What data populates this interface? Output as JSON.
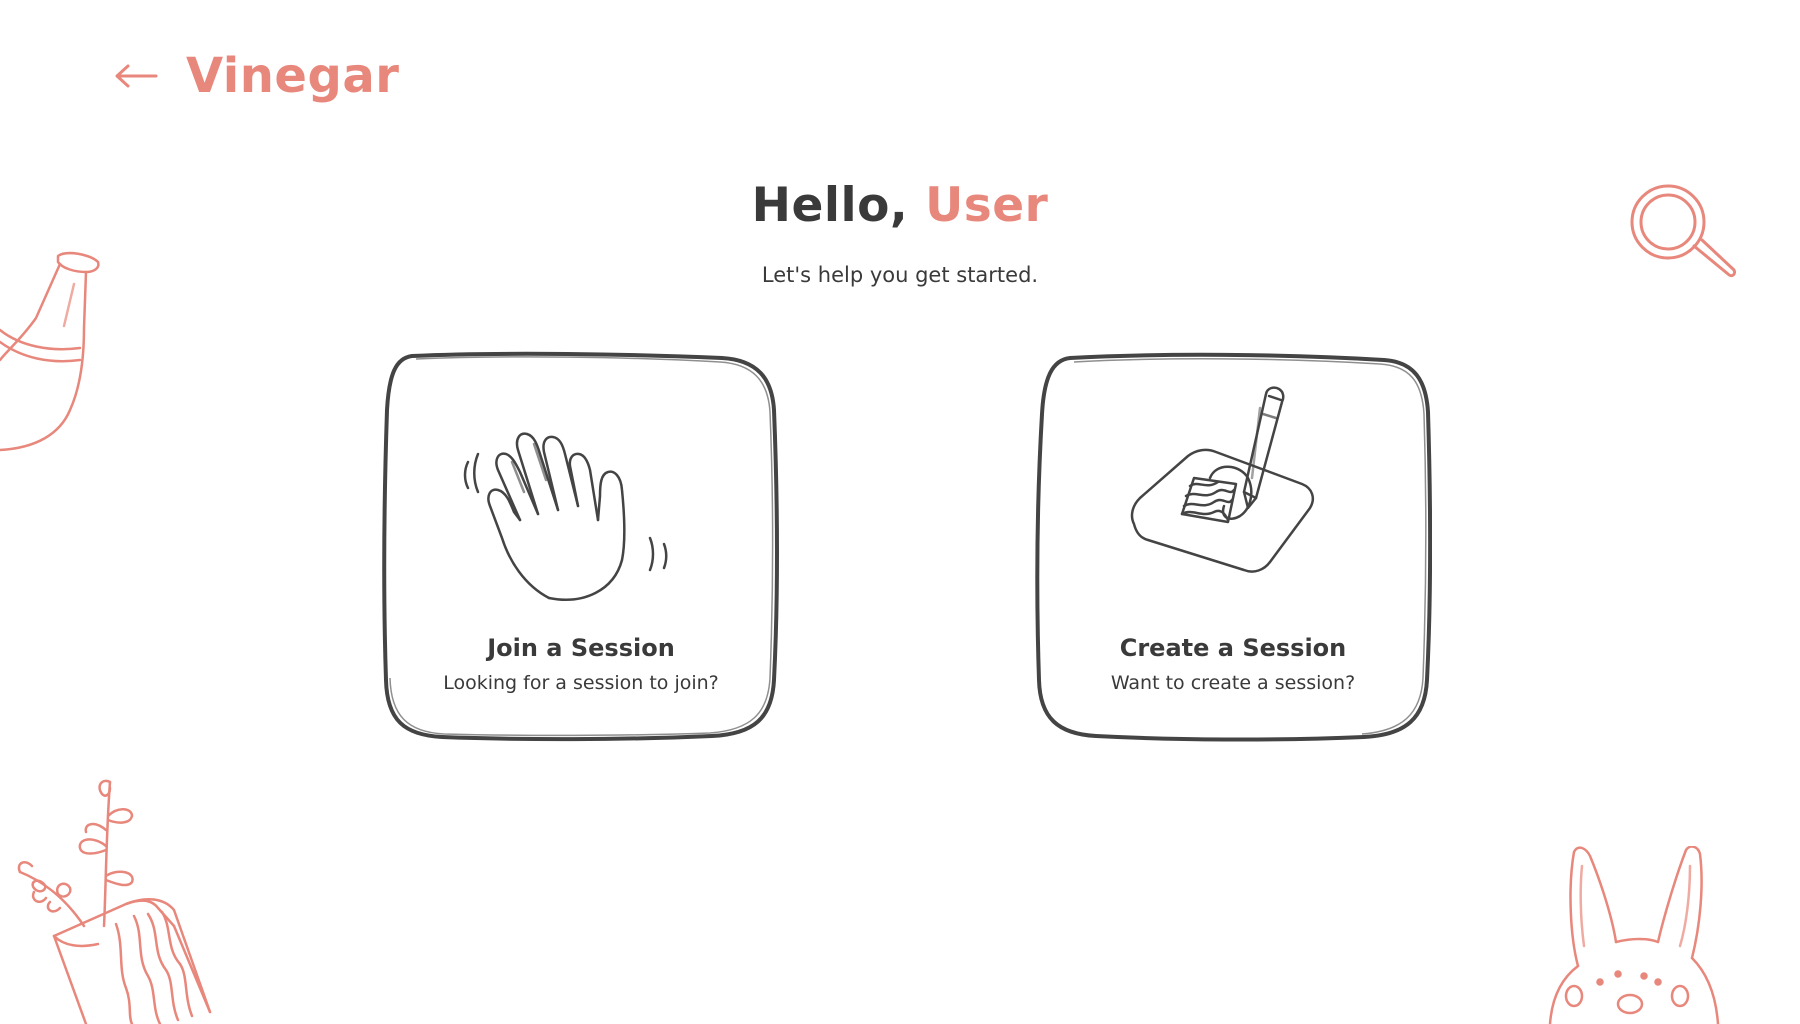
{
  "colors": {
    "accent": "#e8877b",
    "text": "#3a3a3a",
    "stroke": "#444444",
    "background": "#ffffff"
  },
  "header": {
    "back_icon": "arrow-left-icon",
    "brand": "Vinegar"
  },
  "greeting": {
    "prefix": "Hello, ",
    "name": "User"
  },
  "subtitle": "Let's help you get started.",
  "cards": [
    {
      "icon": "waving-hand-icon",
      "title": "Join a Session",
      "description": "Looking for a session to join?"
    },
    {
      "icon": "pencil-drawing-icon",
      "title": "Create a Session",
      "description": "Want to create a session?"
    }
  ],
  "decorations": [
    "vase-doodle",
    "magnifier-doodle",
    "plant-pot-doodle",
    "bunny-doodle"
  ]
}
